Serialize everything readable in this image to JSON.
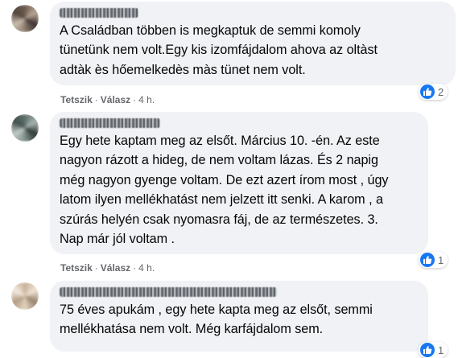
{
  "comments": [
    {
      "text": "A Családban többen is megkaptuk de semmi komoly\ntünetünk nem volt.Egy kis izomfájdalom ahova az oltàst\nadtàk ès hőemelkedès màs tünet nem volt.",
      "like_label": "Tetszik",
      "reply_label": "Válasz",
      "time": "4 h.",
      "reaction_count": "2"
    },
    {
      "text": "Egy hete kaptam meg az elsőt. Március 10. -én. Az este\nnagyon rázott a hideg, de nem voltam lázas. És 2 napig\nmég nagyon gyenge voltam. De ezt azert írom most , úgy\nlatom ilyen mellékhatást nem jelzett itt senki. A karom , a\nszúrás helyén csak nyomasra fáj, de az természetes. 3.\nNap már jól voltam .",
      "like_label": "Tetszik",
      "reply_label": "Válasz",
      "time": "4 h.",
      "reaction_count": "1"
    },
    {
      "text": "75 éves apukám , egy hete kapta meg az elsőt, semmi\nmellékhatása nem volt. Még karfájdalom sem.",
      "reaction_count": "1"
    }
  ],
  "colors": {
    "bubble": "#f0f2f5",
    "meta": "#65676b",
    "like": "#1877f2"
  },
  "icons": [
    "thumbs-up-icon"
  ]
}
